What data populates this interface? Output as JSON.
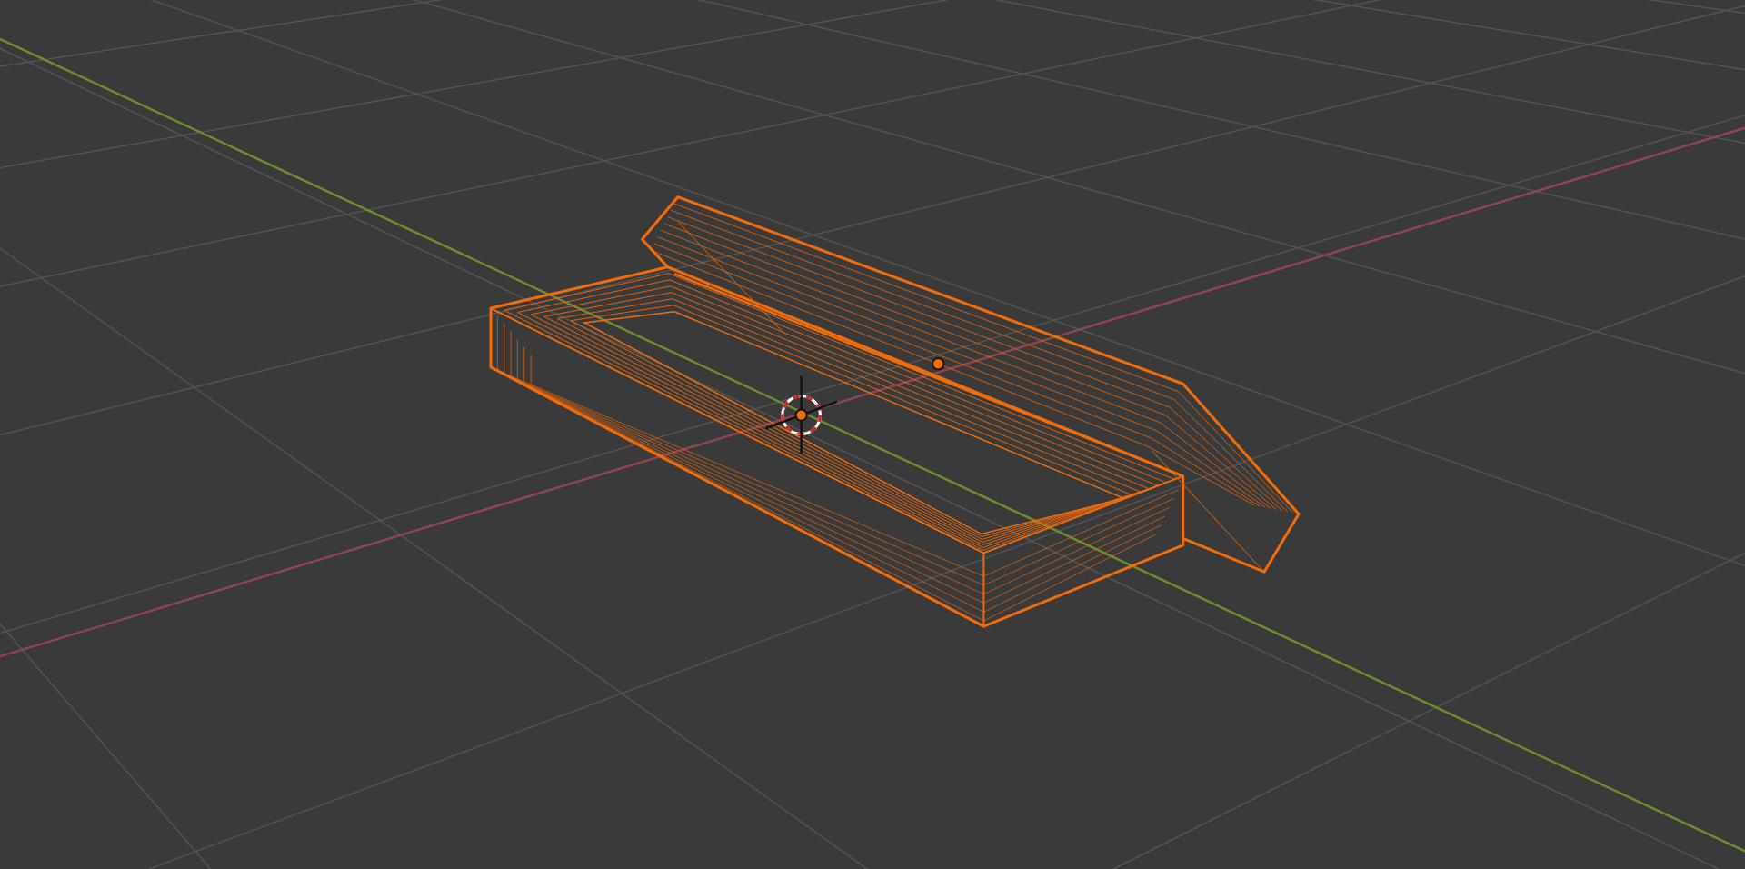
{
  "viewport": {
    "objects": [
      {
        "selected": true
      },
      {
        "selected": true
      }
    ]
  }
}
